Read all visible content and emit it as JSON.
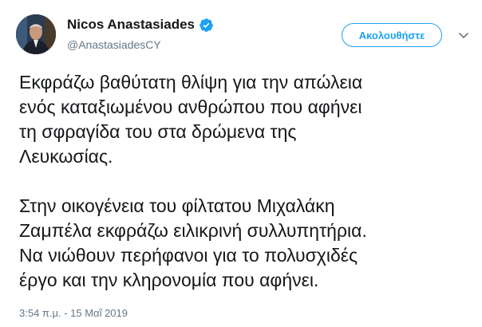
{
  "user": {
    "display_name": "Nicos Anastasiades",
    "handle": "@AnastasiadesCY",
    "verified": true,
    "avatar_icon": "profile-photo"
  },
  "follow_button": {
    "label": "Ακολουθήστε"
  },
  "more_menu_icon": "chevron-down-icon",
  "tweet": {
    "text": "Εκφράζω βαθύτατη θλίψη για την απώλεια\nενός καταξιωμένου ανθρώπου που αφήνει\nτη σφραγίδα του στα δρώμενα της\nΛευκωσίας.\n\nΣτην οικογένεια του φίλτατου Μιχαλάκη\nΖαμπέλα εκφράζω ειλικρινή συλλυπητήρια.\nΝα νιώθουν περήφανοι για το πολυσχιδές\nέργο και την κληρονομία που αφήνει.",
    "timestamp": "3:54 π.μ. - 15 Μαΐ 2019"
  },
  "colors": {
    "accent": "#1da1f2",
    "secondary_text": "#657786",
    "primary_text": "#14171a"
  }
}
